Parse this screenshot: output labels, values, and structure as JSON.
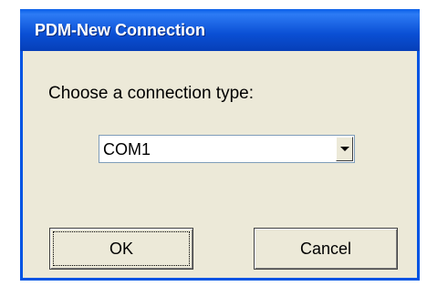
{
  "window": {
    "title": "PDM-New Connection"
  },
  "dialog": {
    "prompt": "Choose a connection type:",
    "connection_type": {
      "selected": "COM1"
    },
    "buttons": {
      "ok": "OK",
      "cancel": "Cancel"
    }
  },
  "colors": {
    "titlebar": "#0a4fd4",
    "window_bg": "#ece9d8",
    "border": "#0054e3"
  },
  "icons": {
    "dropdown": "chevron-down-icon"
  }
}
